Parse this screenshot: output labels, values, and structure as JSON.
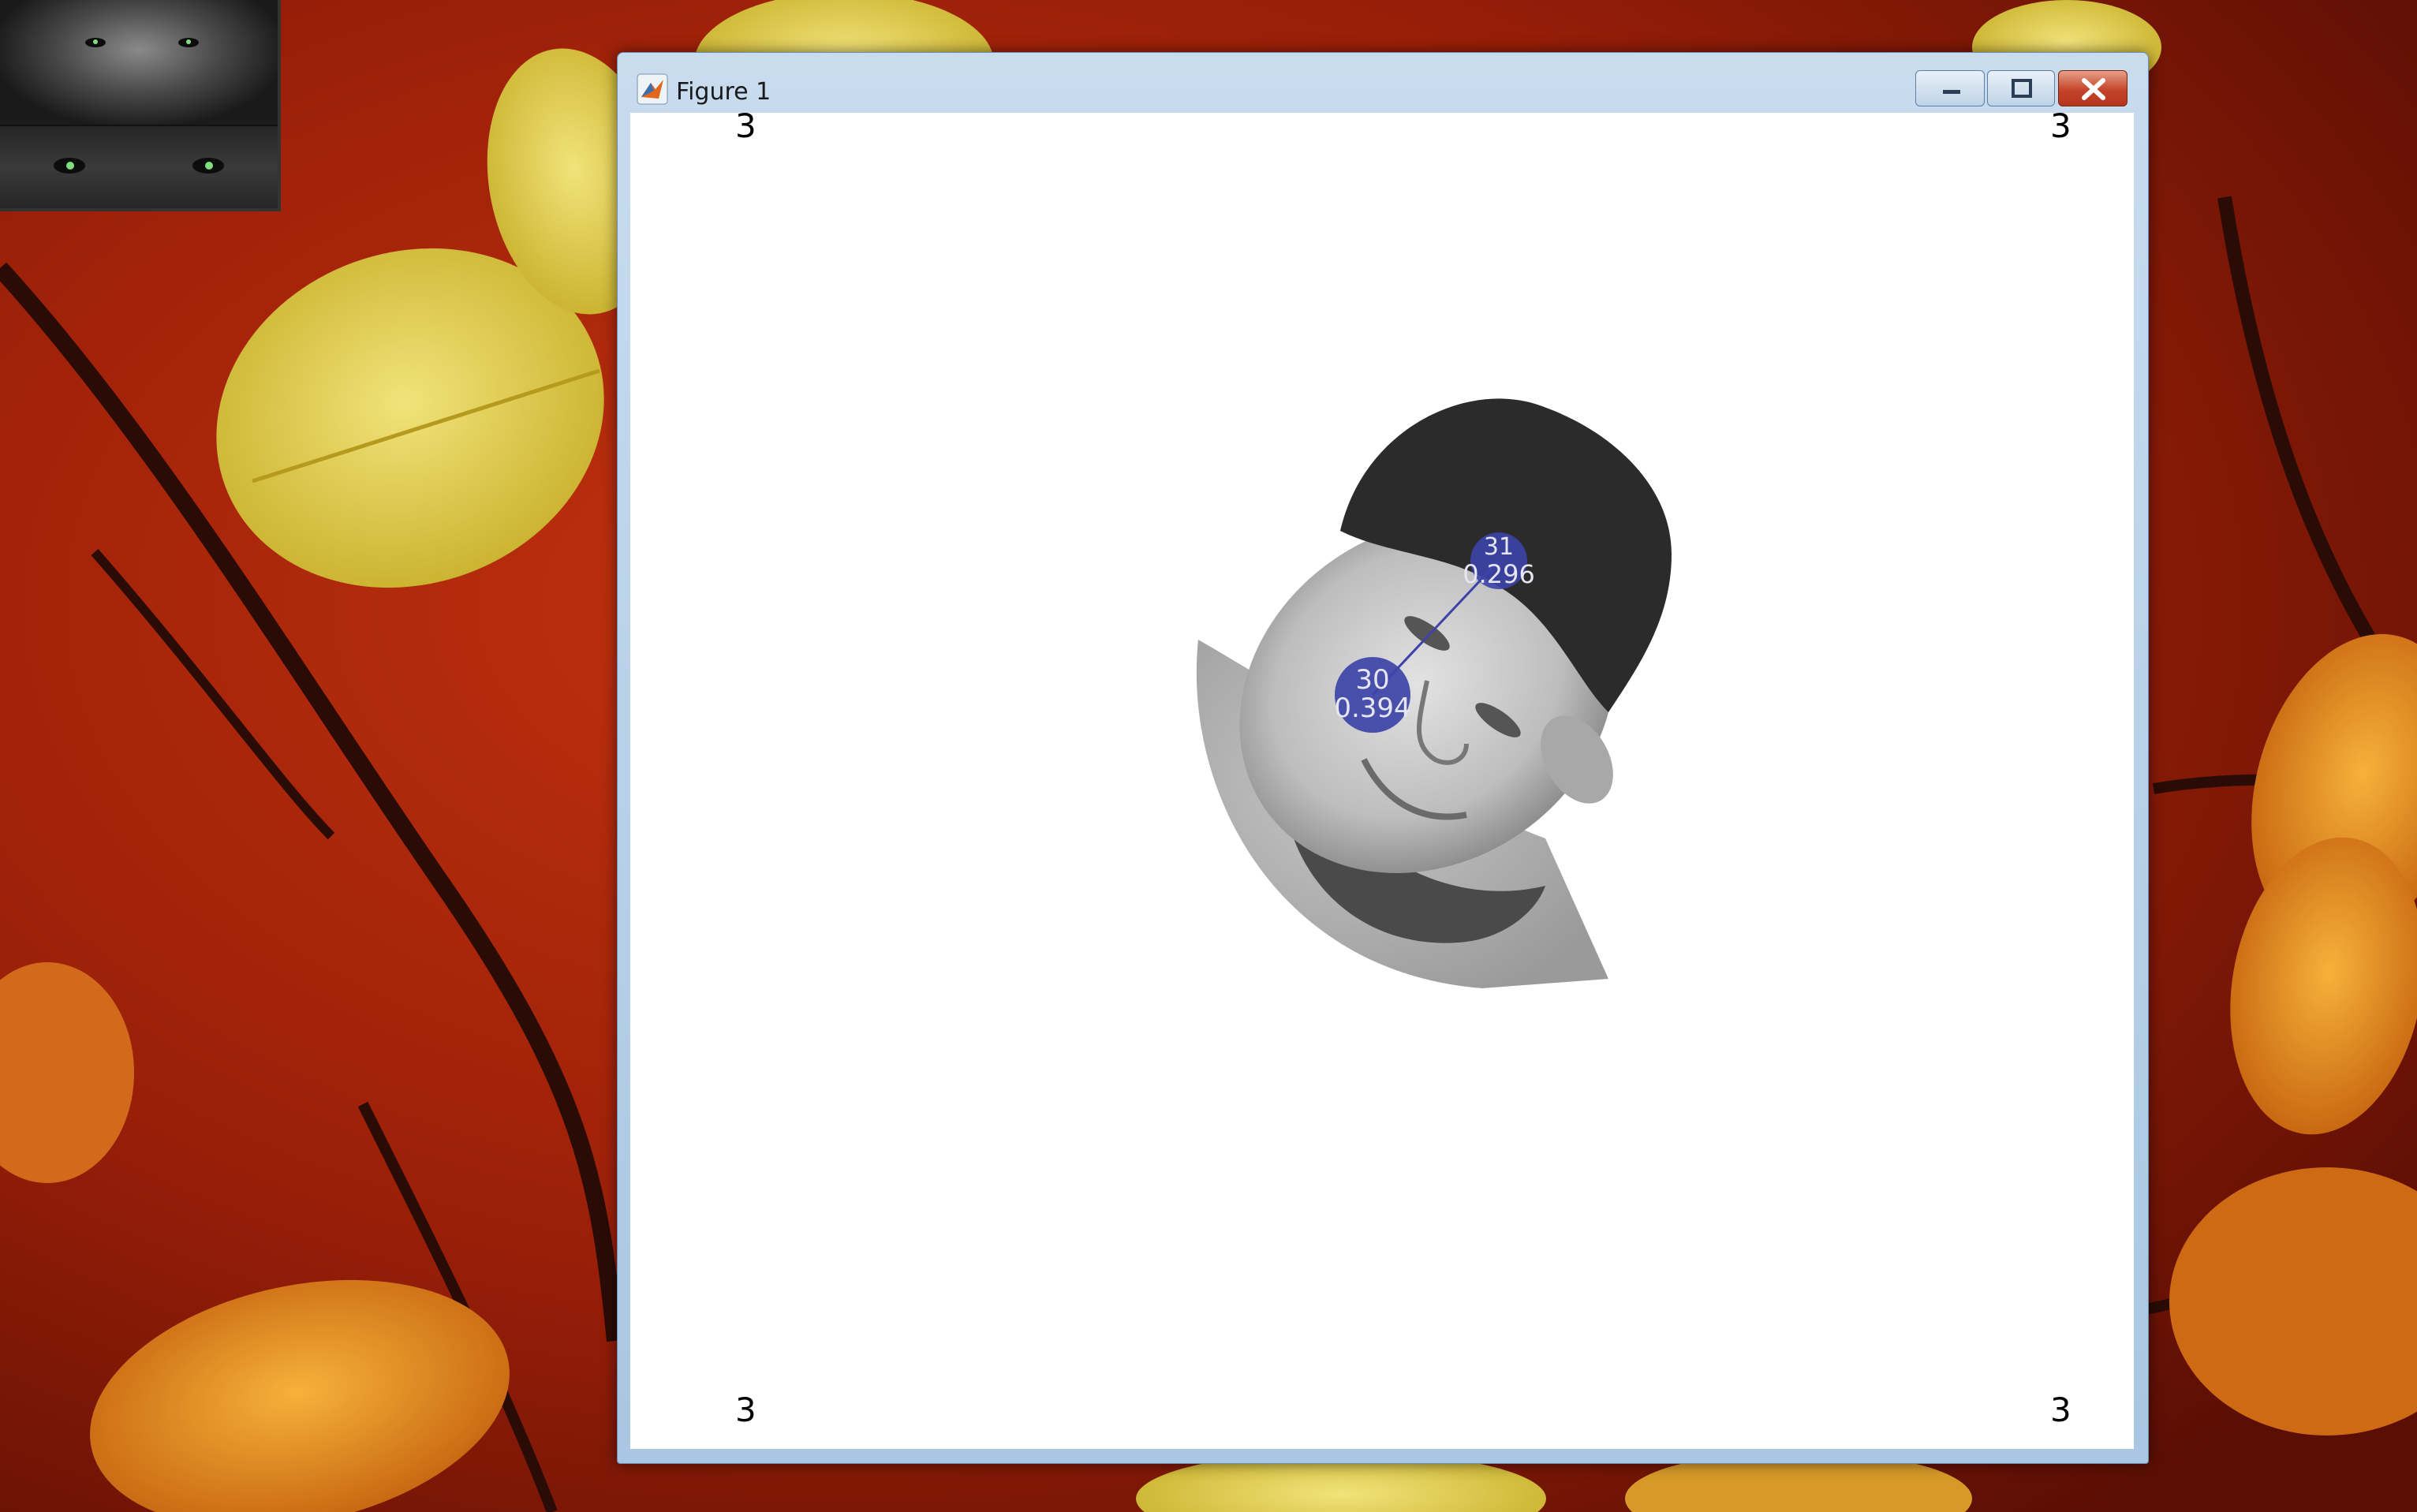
{
  "window": {
    "title": "Figure 1",
    "controls": {
      "minimize": "minimize",
      "maximize": "maximize",
      "close": "close"
    }
  },
  "corners": {
    "top_left": "3",
    "top_right": "3",
    "bottom_left": "3",
    "bottom_right": "3"
  },
  "markers": [
    {
      "id": "31",
      "value": "0.296"
    },
    {
      "id": "30",
      "value": "0.394"
    }
  ],
  "colors": {
    "marker_fill": "#3c44a8",
    "marker_text": "#e6e6f2",
    "canvas": "#ffffff",
    "title_bar": "#b7cfe7",
    "close_button": "#c8442a"
  }
}
